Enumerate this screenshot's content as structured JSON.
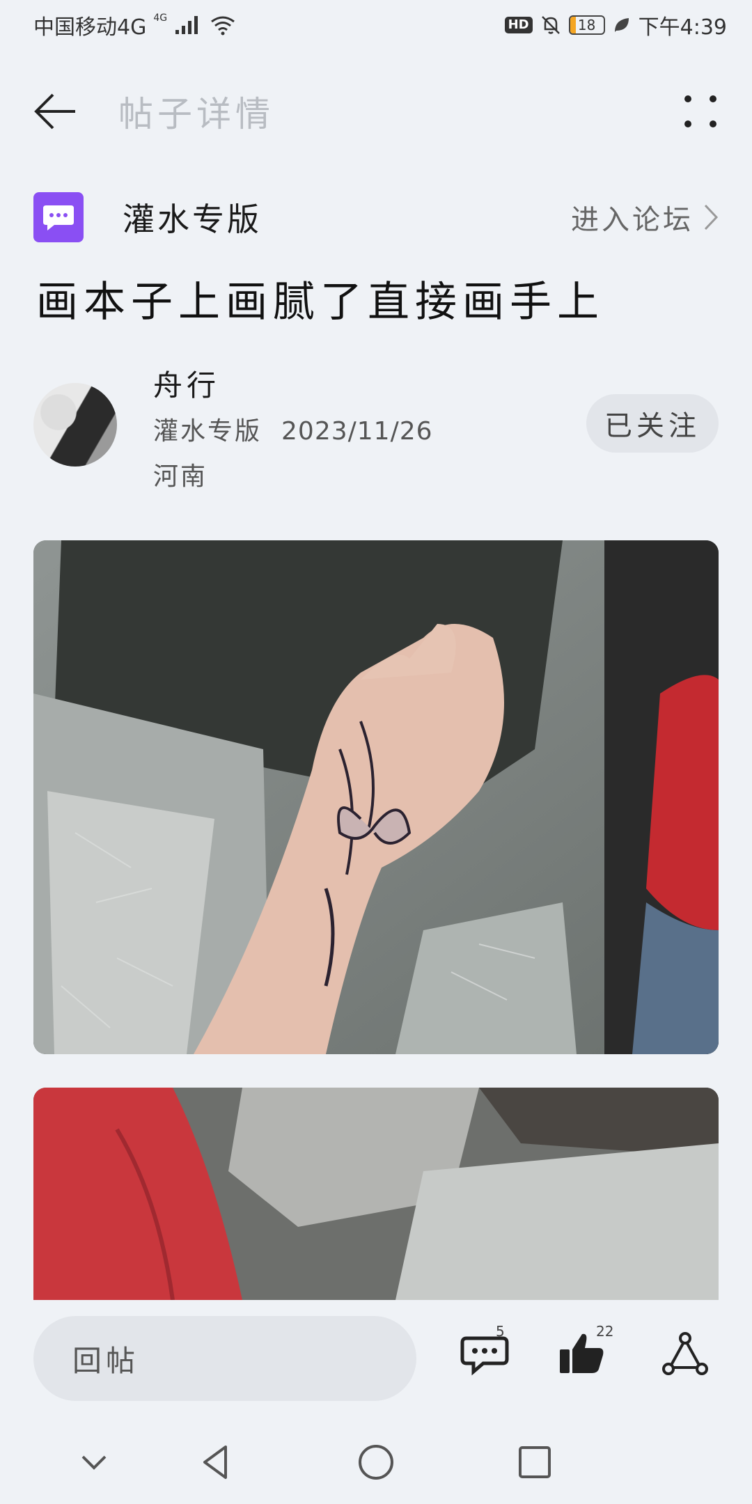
{
  "status_bar": {
    "carrier": "中国移动4G",
    "net_badge": "4G",
    "hd": "HD",
    "battery": "18",
    "battery_level": 0.18,
    "time": "下午4:39"
  },
  "header": {
    "title": "帖子详情",
    "back_icon": "arrow-left-icon",
    "more_icon": "four-dots-icon"
  },
  "forum": {
    "name": "灌水专版",
    "enter_label": "进入论坛",
    "icon": "chat-bubble-icon",
    "icon_color": "#8a4ff3"
  },
  "post": {
    "title": "画本子上画腻了直接画手上"
  },
  "author": {
    "name": "舟行",
    "forum": "灌水专版",
    "date": "2023/11/26",
    "location": "河南",
    "follow_label": "已关注"
  },
  "images": [
    {
      "icon": "photo-hand-butterfly-drawing"
    },
    {
      "icon": "photo-red-cloth"
    }
  ],
  "actions": {
    "reply_placeholder": "回帖",
    "comments_count": "5",
    "likes_count": "22",
    "comment_icon": "comment-icon",
    "like_icon": "thumbs-up-icon",
    "share_icon": "share-icon"
  },
  "nav": {
    "down_icon": "chevron-down-icon",
    "back_icon": "triangle-back-icon",
    "home_icon": "circle-home-icon",
    "recent_icon": "square-recent-icon"
  }
}
